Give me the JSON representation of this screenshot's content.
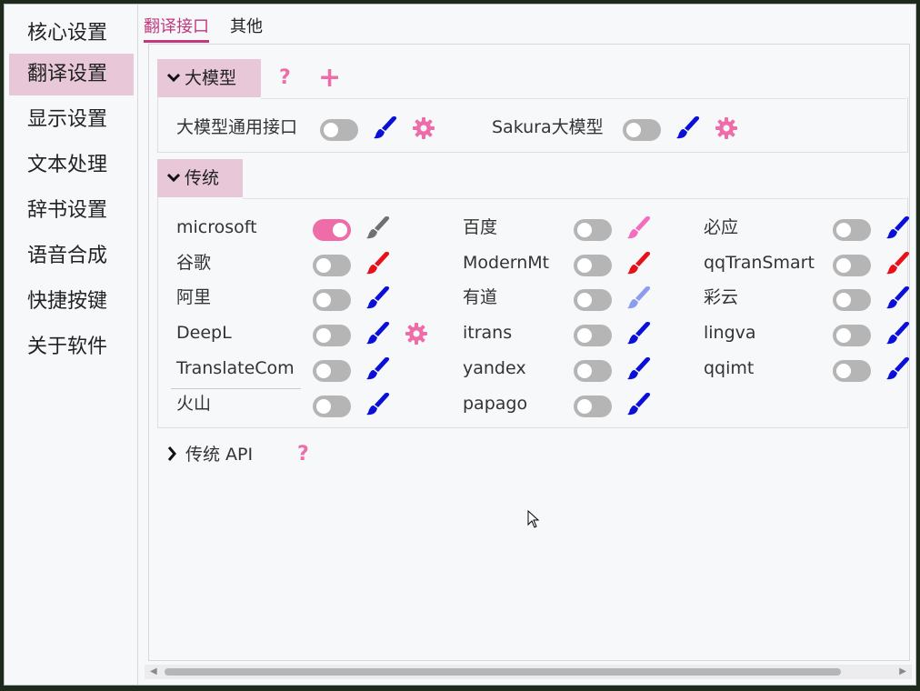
{
  "sidebar": {
    "items": [
      {
        "label": "核心设置",
        "active": false
      },
      {
        "label": "翻译设置",
        "active": true
      },
      {
        "label": "显示设置",
        "active": false
      },
      {
        "label": "文本处理",
        "active": false
      },
      {
        "label": "辞书设置",
        "active": false
      },
      {
        "label": "语音合成",
        "active": false
      },
      {
        "label": "快捷按键",
        "active": false
      },
      {
        "label": "关于软件",
        "active": false
      }
    ]
  },
  "tabs": [
    {
      "label": "翻译接口",
      "active": true
    },
    {
      "label": "其他",
      "active": false
    }
  ],
  "llm_group": {
    "title": "大模型",
    "help_icon": "question-icon",
    "add_icon": "plus-icon",
    "items": [
      {
        "label": "大模型通用接口",
        "on": false,
        "brush_color": "#0a10d8",
        "gear": true
      },
      {
        "label": "Sakura大模型",
        "on": false,
        "brush_color": "#0a10d8",
        "gear": true
      }
    ]
  },
  "traditional_group": {
    "title": "传统",
    "items": [
      {
        "label": "microsoft",
        "on": true,
        "brush_color": "#707070",
        "gear": false
      },
      {
        "label": "百度",
        "on": false,
        "brush_color": "#f56cbf",
        "gear": false
      },
      {
        "label": "必应",
        "on": false,
        "brush_color": "#0a10d8",
        "gear": false
      },
      {
        "label": "谷歌",
        "on": false,
        "brush_color": "#e8111a",
        "gear": false
      },
      {
        "label": "ModernMt",
        "on": false,
        "brush_color": "#e8111a",
        "gear": false
      },
      {
        "label": "qqTranSmart",
        "on": false,
        "brush_color": "#e8111a",
        "gear": false
      },
      {
        "label": "阿里",
        "on": false,
        "brush_color": "#0a10d8",
        "gear": false
      },
      {
        "label": "有道",
        "on": false,
        "brush_color": "#8c9cf0",
        "gear": false
      },
      {
        "label": "彩云",
        "on": false,
        "brush_color": "#0a10d8",
        "gear": false
      },
      {
        "label": "DeepL",
        "on": false,
        "brush_color": "#0a10d8",
        "gear": true
      },
      {
        "label": "itrans",
        "on": false,
        "brush_color": "#0a10d8",
        "gear": false
      },
      {
        "label": "lingva",
        "on": false,
        "brush_color": "#0a10d8",
        "gear": false
      },
      {
        "label": "TranslateCom",
        "on": false,
        "brush_color": "#0a10d8",
        "gear": false
      },
      {
        "label": "yandex",
        "on": false,
        "brush_color": "#0a10d8",
        "gear": false
      },
      {
        "label": "qqimt",
        "on": false,
        "brush_color": "#0a10d8",
        "gear": false
      },
      {
        "label": "火山",
        "on": false,
        "brush_color": "#0a10d8",
        "gear": false
      },
      {
        "label": "papago",
        "on": false,
        "brush_color": "#0a10d8",
        "gear": false
      }
    ]
  },
  "api_group": {
    "title": "传统 API",
    "help_icon": "question-icon"
  },
  "colors": {
    "accent": "#ee6da8",
    "tab_active": "#c2387d",
    "selected_bg": "#e8c8d8",
    "toggle_off": "#b5b5b5"
  }
}
